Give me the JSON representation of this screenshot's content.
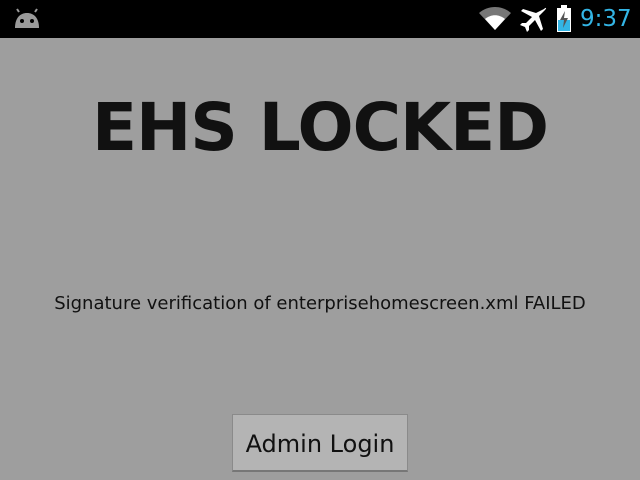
{
  "status_bar": {
    "time": "9:37",
    "clock_color": "#33b5e5",
    "icons": [
      "android-icon",
      "wifi-icon",
      "airplane-mode-icon",
      "battery-charging-icon"
    ]
  },
  "main": {
    "title": "EHS LOCKED",
    "message": "Signature verification of enterprisehomescreen.xml FAILED",
    "admin_button_label": "Admin Login"
  },
  "colors": {
    "background": "#9e9e9e",
    "status_bar": "#000000",
    "text": "#111111"
  }
}
